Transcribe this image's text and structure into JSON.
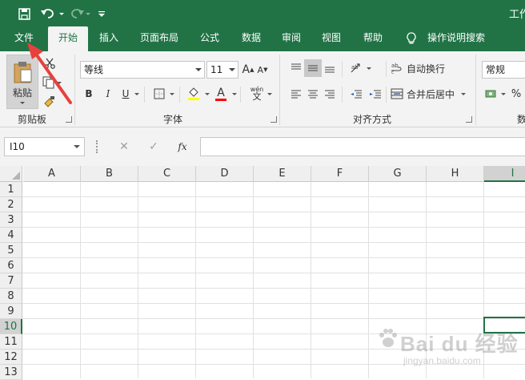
{
  "title_bar": {
    "title": "工作"
  },
  "tabs": [
    {
      "label": "文件",
      "active": false
    },
    {
      "label": "开始",
      "active": true
    },
    {
      "label": "插入",
      "active": false
    },
    {
      "label": "页面布局",
      "active": false
    },
    {
      "label": "公式",
      "active": false
    },
    {
      "label": "数据",
      "active": false
    },
    {
      "label": "审阅",
      "active": false
    },
    {
      "label": "视图",
      "active": false
    },
    {
      "label": "帮助",
      "active": false
    },
    {
      "label": "操作说明搜索",
      "active": false,
      "icon": "lightbulb-icon"
    }
  ],
  "ribbon": {
    "clipboard": {
      "paste_label": "粘贴",
      "group_label": "剪贴板"
    },
    "font": {
      "font_name": "等线",
      "font_size": "11",
      "group_label": "字体",
      "bold": "B",
      "italic": "I",
      "underline": "U",
      "font_color_letter": "A",
      "grow": "A",
      "shrink": "A",
      "phonetic": "wén"
    },
    "alignment": {
      "wrap_text": "自动换行",
      "merge_center": "合并后居中",
      "group_label": "对齐方式"
    },
    "number": {
      "format": "常规",
      "group_label": "数"
    }
  },
  "formula_bar": {
    "name_box": "I10",
    "fx": "fx",
    "formula": ""
  },
  "grid": {
    "columns": [
      "A",
      "B",
      "C",
      "D",
      "E",
      "F",
      "G",
      "H",
      "I"
    ],
    "rows": [
      "1",
      "2",
      "3",
      "4",
      "5",
      "6",
      "7",
      "8",
      "9",
      "10",
      "11",
      "12",
      "13"
    ],
    "selected_column": "I",
    "selected_row": "10"
  },
  "watermark": {
    "line1": "Bai du 经验",
    "line2": "jingyan.baidu.com"
  },
  "colors": {
    "accent": "#217346",
    "arrow": "#e8403c"
  }
}
